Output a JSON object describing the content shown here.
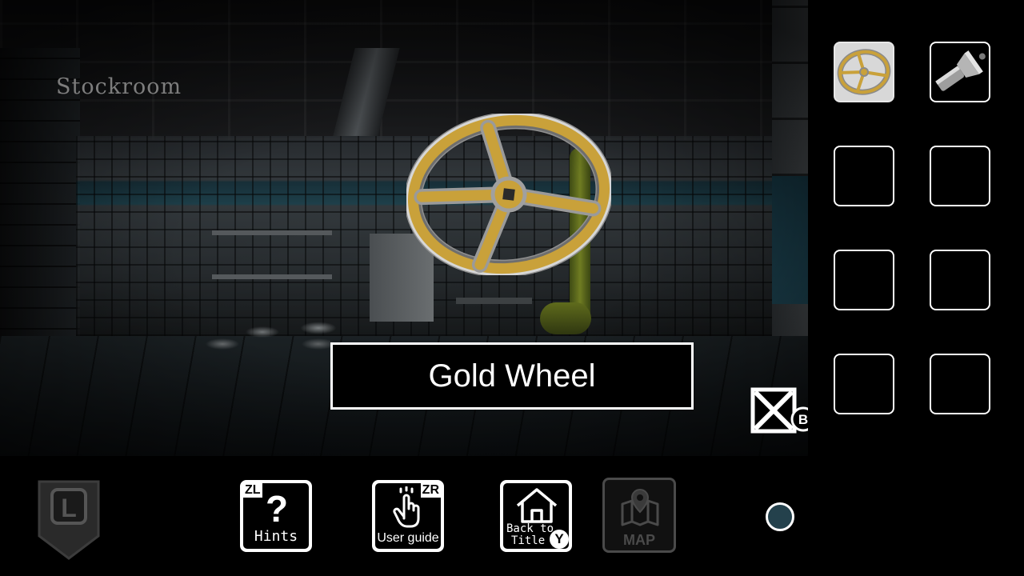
{
  "scene": {
    "room_name": "Stockroom",
    "item_name": "Gold Wheel",
    "close_button_key": "B"
  },
  "inventory": {
    "slots": [
      {
        "item": "gold-wheel",
        "selected": true
      },
      {
        "item": "flashlight",
        "selected": false
      },
      {
        "item": "",
        "selected": false
      },
      {
        "item": "",
        "selected": false
      },
      {
        "item": "",
        "selected": false
      },
      {
        "item": "",
        "selected": false
      },
      {
        "item": "",
        "selected": false
      },
      {
        "item": "",
        "selected": false
      }
    ]
  },
  "toolbar": {
    "back_key": "L",
    "hints": {
      "label": "Hints",
      "key": "ZL"
    },
    "user_guide": {
      "label": "User guide",
      "key": "ZR"
    },
    "back_to_title": {
      "label_line1": "Back to",
      "label_line2": "Title",
      "key": "Y"
    },
    "map": {
      "label": "MAP",
      "enabled": false
    }
  },
  "colors": {
    "accent_gold": "#c9a13a",
    "page_dot": "#24414c",
    "disabled": "#4a4a4a"
  }
}
